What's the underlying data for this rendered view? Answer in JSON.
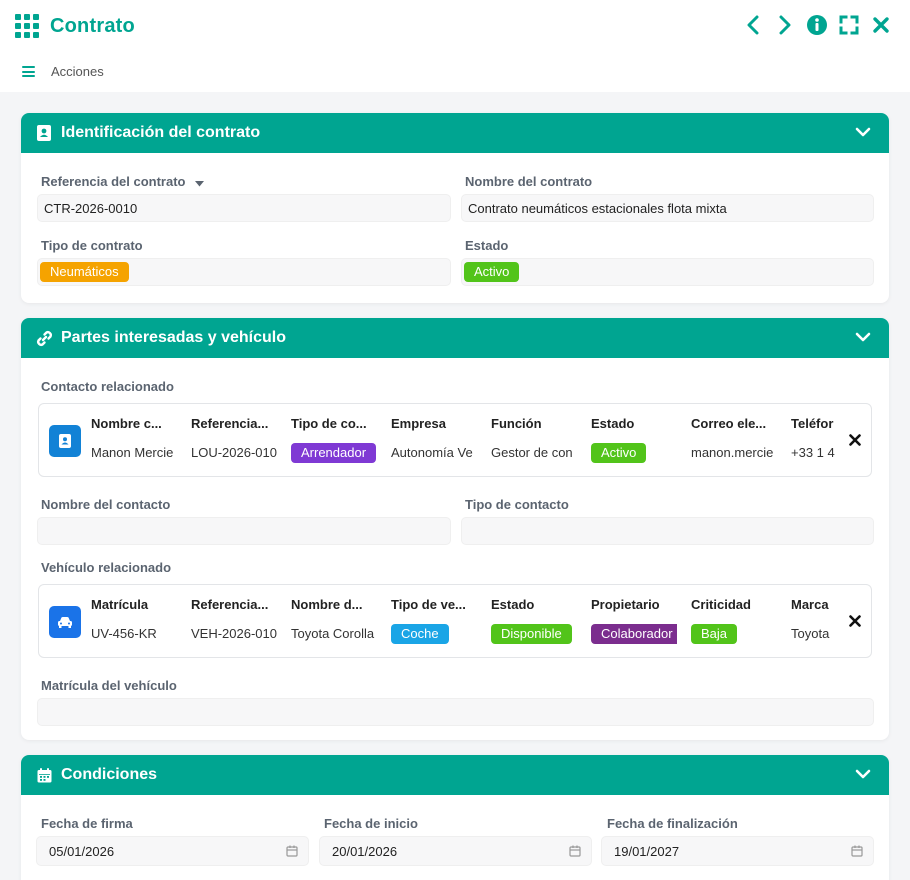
{
  "app": {
    "title": "Contrato",
    "actions_label": "Acciones"
  },
  "colors": {
    "accent": "#00a591",
    "orange": "#f5a300",
    "green": "#52c41a",
    "purple": "#7f39d4",
    "blue": "#1aa5e6",
    "darkpurple": "#7b2d8e"
  },
  "identification": {
    "title": "Identificación del contrato",
    "reference_label": "Referencia del contrato",
    "reference_value": "CTR-2026-0010",
    "name_label": "Nombre del contrato",
    "name_value": "Contrato neumáticos estacionales flota mixta",
    "type_label": "Tipo de contrato",
    "type_value": "Neumáticos",
    "status_label": "Estado",
    "status_value": "Activo"
  },
  "parties": {
    "title": "Partes interesadas y vehículo",
    "contact_rel_label": "Contacto relacionado",
    "contact_columns": [
      {
        "header": "Nombre c...",
        "value": "Manon Mercie"
      },
      {
        "header": "Referencia...",
        "value": "LOU-2026-010"
      },
      {
        "header": "Tipo de co...",
        "value": "Arrendador"
      },
      {
        "header": "Empresa",
        "value": "Autonomía Ve"
      },
      {
        "header": "Función",
        "value": "Gestor de con"
      },
      {
        "header": "Estado",
        "value": "Activo"
      },
      {
        "header": "Correo ele...",
        "value": "manon.mercie"
      },
      {
        "header": "Teléfor",
        "value": "+33 1 4"
      }
    ],
    "contact_name_label": "Nombre del contacto",
    "contact_type_label": "Tipo de contacto",
    "vehicle_rel_label": "Vehículo relacionado",
    "vehicle_columns": [
      {
        "header": "Matrícula",
        "value": "UV-456-KR"
      },
      {
        "header": "Referencia...",
        "value": "VEH-2026-010"
      },
      {
        "header": "Nombre d...",
        "value": "Toyota Corolla"
      },
      {
        "header": "Tipo de ve...",
        "value": "Coche"
      },
      {
        "header": "Estado",
        "value": "Disponible"
      },
      {
        "header": "Propietario",
        "value": "Colaborador"
      },
      {
        "header": "Criticidad",
        "value": "Baja"
      },
      {
        "header": "Marca",
        "value": "Toyota"
      }
    ],
    "vehicle_plate_label": "Matrícula del vehículo"
  },
  "conditions": {
    "title": "Condiciones",
    "sign_label": "Fecha de firma",
    "sign_value": "05/01/2026",
    "start_label": "Fecha de inicio",
    "start_value": "20/01/2026",
    "end_label": "Fecha de finalización",
    "end_value": "19/01/2027"
  }
}
